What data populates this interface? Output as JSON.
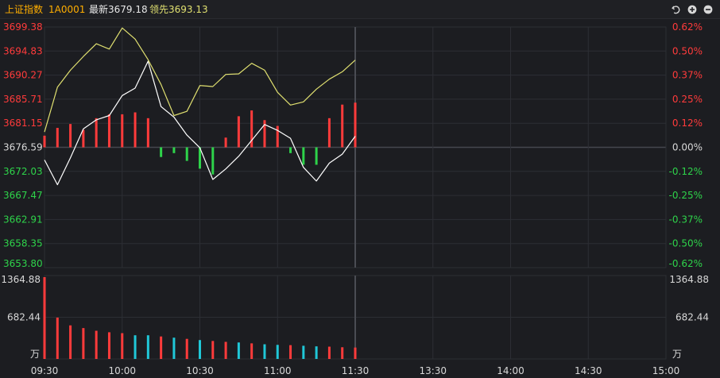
{
  "header": {
    "index_name": "上证指数",
    "index_code": "1A0001",
    "latest_label": "最新3679.18",
    "leading_label": "领先3693.13",
    "icons": [
      "undo-icon",
      "zoom-in-icon",
      "zoom-out-icon"
    ]
  },
  "colors": {
    "up": "#ff3b3b",
    "down": "#2ed34a",
    "price_line": "#ffffff",
    "leading_line": "#e0e070",
    "volume_up": "#ff3b3b",
    "volume_down": "#20c8d8",
    "header_name": "#ffae00",
    "grid": "#2c2e34"
  },
  "chart_data": {
    "type": "line",
    "pre_close": 3676.59,
    "ylim": [
      3653.8,
      3699.38
    ],
    "price_ticks": [
      "3699.38",
      "3694.83",
      "3690.27",
      "3685.71",
      "3681.15",
      "3676.59",
      "3672.03",
      "3667.47",
      "3662.91",
      "3658.35",
      "3653.80"
    ],
    "pct_ticks": [
      "0.62%",
      "0.50%",
      "0.37%",
      "0.25%",
      "0.12%",
      "0.00%",
      "-0.12%",
      "-0.25%",
      "-0.37%",
      "-0.50%",
      "-0.62%"
    ],
    "x_ticks": [
      "09:30",
      "10:00",
      "10:30",
      "11:00",
      "11:30",
      "13:30",
      "14:00",
      "14:30",
      "15:00"
    ],
    "x_minutes": [
      0,
      30,
      60,
      90,
      120,
      150,
      180,
      210,
      240
    ],
    "volume_ticks": [
      "1364.88",
      "682.44"
    ],
    "volume_unit": "万",
    "volume_max": 1364.88,
    "series": [
      {
        "role": "price",
        "x": [
          0,
          5,
          10,
          15,
          20,
          25,
          30,
          35,
          40,
          45,
          50,
          55,
          60,
          65,
          70,
          75,
          80,
          85,
          90,
          95,
          100,
          105,
          110,
          115,
          120
        ],
        "values": [
          3674.2,
          3669.5,
          3674.6,
          3680.1,
          3681.8,
          3682.6,
          3686.4,
          3687.8,
          3692.9,
          3684.3,
          3682.3,
          3678.9,
          3676.5,
          3670.5,
          3672.5,
          3674.9,
          3677.9,
          3680.9,
          3679.8,
          3678.3,
          3672.8,
          3670.2,
          3673.6,
          3675.3,
          3678.7
        ]
      },
      {
        "role": "leading",
        "x": [
          0,
          5,
          10,
          15,
          20,
          25,
          30,
          35,
          40,
          45,
          50,
          55,
          60,
          65,
          70,
          75,
          80,
          85,
          90,
          95,
          100,
          105,
          110,
          115,
          120
        ],
        "values": [
          3679.5,
          3688.0,
          3691.2,
          3693.8,
          3696.2,
          3695.2,
          3699.2,
          3697.1,
          3693.2,
          3688.5,
          3682.6,
          3683.4,
          3688.3,
          3688.1,
          3690.4,
          3690.5,
          3692.5,
          3691.2,
          3687.0,
          3684.6,
          3685.2,
          3687.6,
          3689.5,
          3690.9,
          3693.1
        ]
      }
    ],
    "strength_bars": {
      "x": [
        0,
        5,
        10,
        15,
        20,
        25,
        30,
        35,
        40,
        45,
        50,
        55,
        60,
        65,
        70,
        75,
        80,
        85,
        90,
        95,
        100,
        105,
        110,
        115,
        120
      ],
      "values": [
        0.06,
        0.1,
        0.12,
        0.09,
        0.15,
        0.17,
        0.17,
        0.18,
        0.15,
        -0.05,
        -0.03,
        -0.07,
        -0.11,
        -0.14,
        0.05,
        0.16,
        0.19,
        0.14,
        0.11,
        -0.03,
        -0.09,
        -0.09,
        0.15,
        0.22,
        0.23
      ]
    },
    "volume": {
      "x": [
        0,
        5,
        10,
        15,
        20,
        25,
        30,
        35,
        40,
        45,
        50,
        55,
        60,
        65,
        70,
        75,
        80,
        85,
        90,
        95,
        100,
        105,
        110,
        115,
        120
      ],
      "values": [
        1364.88,
        690,
        560,
        515,
        470,
        445,
        430,
        395,
        395,
        375,
        355,
        335,
        315,
        300,
        285,
        275,
        260,
        245,
        235,
        230,
        220,
        210,
        205,
        195,
        190
      ],
      "up": [
        true,
        true,
        true,
        true,
        true,
        true,
        true,
        false,
        false,
        true,
        false,
        true,
        false,
        true,
        true,
        false,
        true,
        false,
        false,
        true,
        false,
        false,
        true,
        true,
        true
      ]
    }
  }
}
